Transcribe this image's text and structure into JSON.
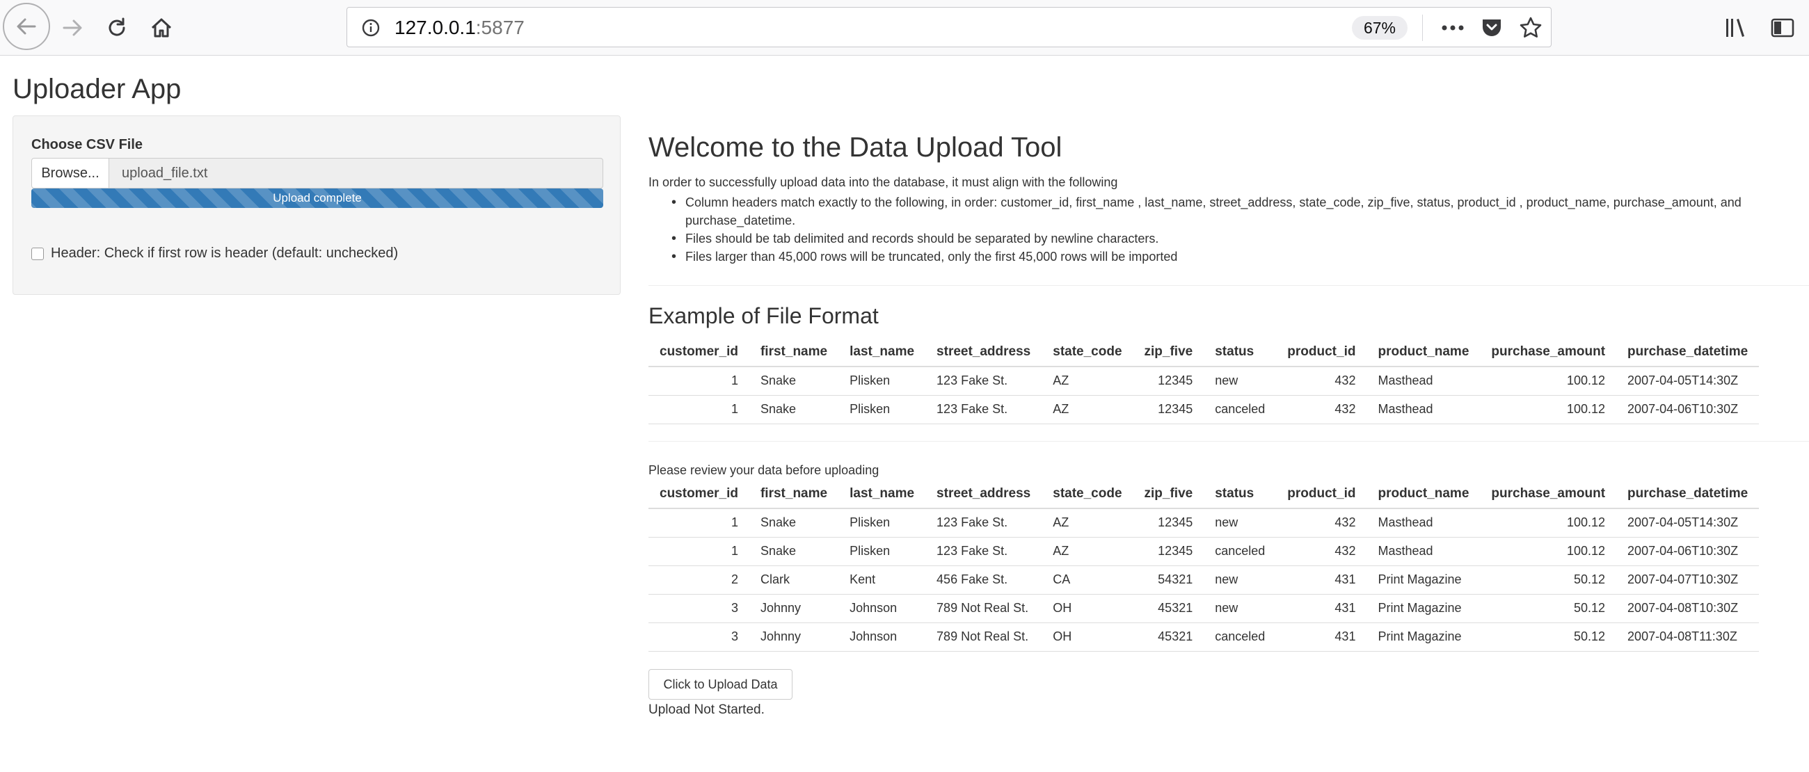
{
  "browser": {
    "url_host": "127.0.0.1",
    "url_port": ":5877",
    "zoom": "67%",
    "icons": [
      "back-arrow-icon",
      "forward-arrow-icon",
      "reload-icon",
      "home-icon",
      "info-icon",
      "more-icon",
      "pocket-icon",
      "star-icon",
      "library-icon",
      "sidebar-icon"
    ]
  },
  "app": {
    "title": "Uploader App"
  },
  "sidebar": {
    "file_label": "Choose CSV File",
    "browse_label": "Browse...",
    "file_name": "upload_file.txt",
    "progress_text": "Upload complete",
    "progress_fraction": 1.0,
    "header_checkbox_label": "Header: Check if first row is header (default: unchecked)",
    "header_checked": false
  },
  "main": {
    "welcome_title": "Welcome to the Data Upload Tool",
    "intro": "In order to successfully upload data into the database, it must align with the following",
    "rules": [
      "Column headers match exactly to the following, in order: customer_id, first_name , last_name, street_address, state_code, zip_five, status, product_id , product_name, purchase_amount, and purchase_datetime.",
      "Files should be tab delimited and records should be separated by newline characters.",
      "Files larger than 45,000 rows will be truncated, only the first 45,000 rows will be imported"
    ],
    "example_title": "Example of File Format",
    "review_text": "Please review your data before uploading",
    "upload_button": "Click to Upload Data",
    "upload_status": "Upload Not Started."
  },
  "columns": [
    "customer_id",
    "first_name",
    "last_name",
    "street_address",
    "state_code",
    "zip_five",
    "status",
    "product_id",
    "product_name",
    "purchase_amount",
    "purchase_datetime"
  ],
  "example_rows": [
    [
      "1",
      "Snake",
      "Plisken",
      "123 Fake St.",
      "AZ",
      "12345",
      "new",
      "432",
      "Masthead",
      "100.12",
      "2007-04-05T14:30Z"
    ],
    [
      "1",
      "Snake",
      "Plisken",
      "123 Fake St.",
      "AZ",
      "12345",
      "canceled",
      "432",
      "Masthead",
      "100.12",
      "2007-04-06T10:30Z"
    ]
  ],
  "review_rows": [
    [
      "1",
      "Snake",
      "Plisken",
      "123 Fake St.",
      "AZ",
      "12345",
      "new",
      "432",
      "Masthead",
      "100.12",
      "2007-04-05T14:30Z"
    ],
    [
      "1",
      "Snake",
      "Plisken",
      "123 Fake St.",
      "AZ",
      "12345",
      "canceled",
      "432",
      "Masthead",
      "100.12",
      "2007-04-06T10:30Z"
    ],
    [
      "2",
      "Clark",
      "Kent",
      "456 Fake St.",
      "CA",
      "54321",
      "new",
      "431",
      "Print Magazine",
      "50.12",
      "2007-04-07T10:30Z"
    ],
    [
      "3",
      "Johnny",
      "Johnson",
      "789 Not Real St.",
      "OH",
      "45321",
      "new",
      "431",
      "Print Magazine",
      "50.12",
      "2007-04-08T10:30Z"
    ],
    [
      "3",
      "Johnny",
      "Johnson",
      "789 Not Real St.",
      "OH",
      "45321",
      "canceled",
      "431",
      "Print Magazine",
      "50.12",
      "2007-04-08T11:30Z"
    ]
  ]
}
